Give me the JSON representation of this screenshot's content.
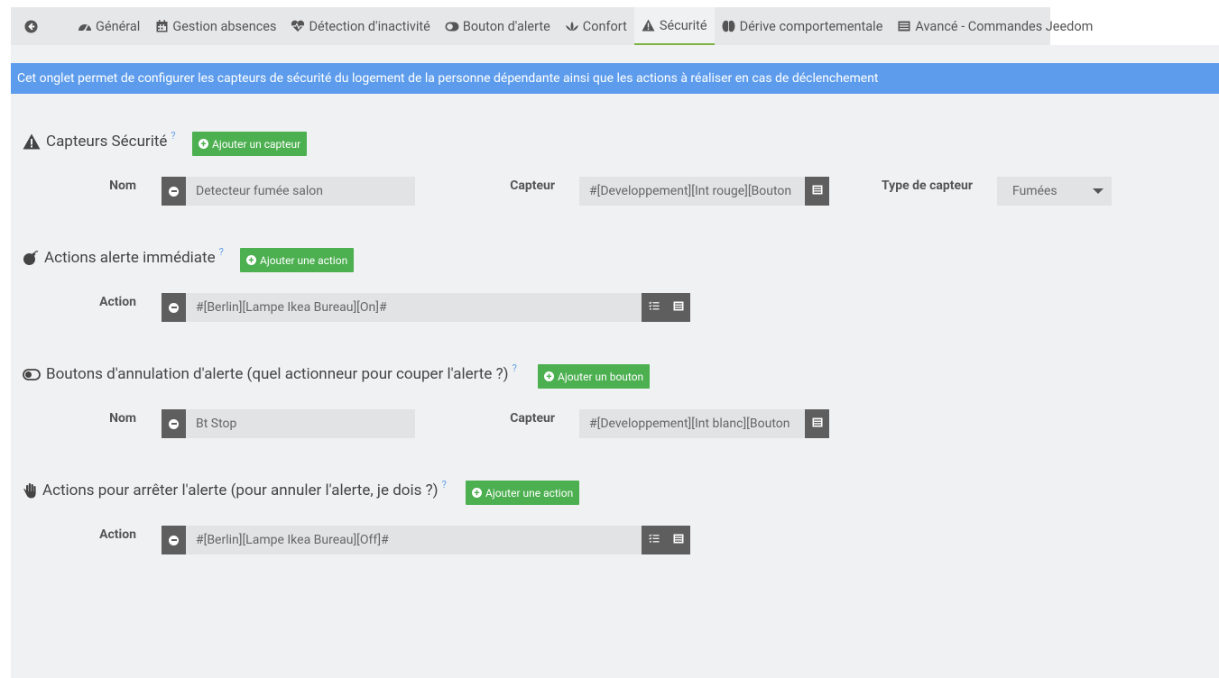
{
  "tabs": [
    {
      "label": ""
    },
    {
      "label": "Général"
    },
    {
      "label": "Gestion absences"
    },
    {
      "label": "Détection d'inactivité"
    },
    {
      "label": "Bouton d'alerte"
    },
    {
      "label": "Confort"
    },
    {
      "label": "Sécurité"
    },
    {
      "label": "Dérive comportementale"
    },
    {
      "label": "Avancé - Commandes Jeedom"
    }
  ],
  "banner": "Cet onglet permet de configurer les capteurs de sécurité du logement de la personne dépendante ainsi que les actions à réaliser en cas de déclenchement",
  "help_mark": "?",
  "sections": {
    "sensors": {
      "title": "Capteurs Sécurité",
      "add_label": "Ajouter un capteur",
      "name_label": "Nom",
      "name_value": "Detecteur fumée salon",
      "sensor_label": "Capteur",
      "sensor_value": "#[Developpement][Int rouge][Bouton",
      "type_label": "Type de capteur",
      "type_value": "Fumées"
    },
    "immediate": {
      "title": "Actions alerte immédiate",
      "add_label": "Ajouter une action",
      "action_label": "Action",
      "action_value": "#[Berlin][Lampe Ikea Bureau][On]#"
    },
    "cancel_buttons": {
      "title": "Boutons d'annulation d'alerte (quel actionneur pour couper l'alerte ?)",
      "add_label": "Ajouter un bouton",
      "name_label": "Nom",
      "name_value": "Bt Stop",
      "sensor_label": "Capteur",
      "sensor_value": "#[Developpement][Int blanc][Bouton"
    },
    "stop_actions": {
      "title": "Actions pour arrêter l'alerte (pour annuler l'alerte, je dois ?)",
      "add_label": "Ajouter une action",
      "action_label": "Action",
      "action_value": "#[Berlin][Lampe Ikea Bureau][Off]#"
    }
  },
  "colors": {
    "banner": "#5d9cec",
    "add_button": "#4caf50",
    "active_tab_underline": "#7cb342",
    "help": "#5d9cec"
  }
}
